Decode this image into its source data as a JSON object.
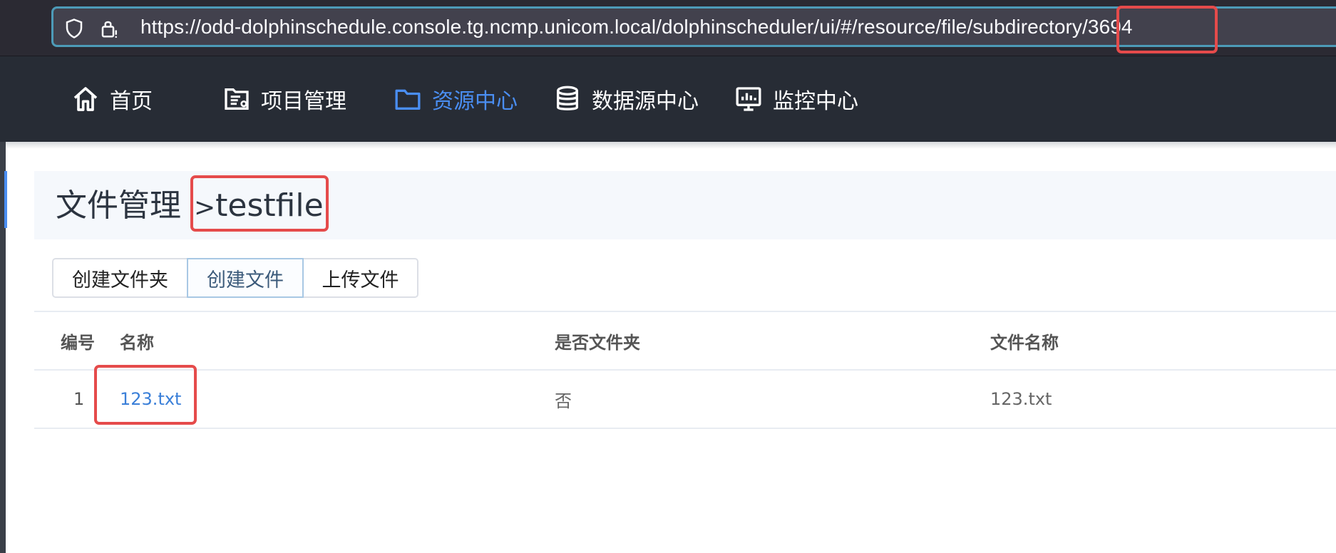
{
  "browser": {
    "url": "https://odd-dolphinschedule.console.tg.ncmp.unicom.local/dolphinscheduler/ui/#/resource/file/subdirectory/3694"
  },
  "nav": {
    "items": [
      {
        "label": "首页",
        "icon": "home-icon"
      },
      {
        "label": "项目管理",
        "icon": "project-icon"
      },
      {
        "label": "资源中心",
        "icon": "folder-icon",
        "active": true
      },
      {
        "label": "数据源中心",
        "icon": "database-icon"
      },
      {
        "label": "监控中心",
        "icon": "monitor-icon"
      }
    ]
  },
  "breadcrumb": {
    "root": "文件管理",
    "separator": ">",
    "current": "testfile"
  },
  "toolbar": {
    "create_folder": "创建文件夹",
    "create_file": "创建文件",
    "upload_file": "上传文件"
  },
  "table": {
    "headers": [
      "编号",
      "名称",
      "是否文件夹",
      "文件名称"
    ],
    "rows": [
      {
        "no": "1",
        "name": "123.txt",
        "is_folder": "否",
        "file_name": "123.txt"
      }
    ]
  },
  "colors": {
    "accent": "#4a8ef2",
    "highlight": "#e54b4b",
    "nav_bg": "#272c35"
  }
}
